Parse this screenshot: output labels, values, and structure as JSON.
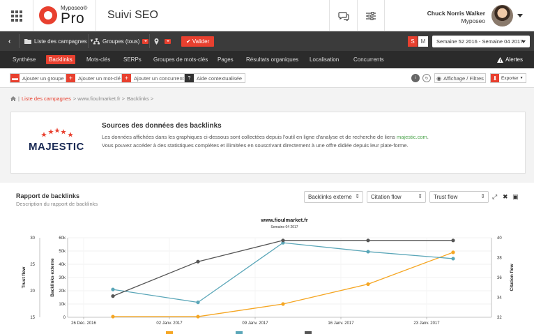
{
  "header": {
    "logo_top": "Myposeo®",
    "logo_main": "Pro",
    "app_title": "Suivi SEO",
    "user_name": "Chuck Norris Walker",
    "user_company": "Myposeo"
  },
  "toolbar": {
    "campaigns_label": "Liste des campagnes",
    "groups_label": "Groupes (tous)",
    "validate_label": "✔ Valider",
    "period_s": "S",
    "period_m": "M",
    "week_range": "Semaine 52 2016 - Semaine 04 2017"
  },
  "nav": {
    "tabs": [
      "Synthèse",
      "Backlinks",
      "Mots-clés",
      "SERPs",
      "Groupes de mots-clés",
      "Pages",
      "Résultats organiques",
      "Localisation",
      "Concurrents"
    ],
    "active": "Backlinks",
    "alerts_label": "Alertes"
  },
  "actions": {
    "add_group": "Ajouter un groupe",
    "add_keyword": "Ajouter un mot-clé",
    "add_competitor": "Ajouter un concurrent",
    "help": "Aide contextualisée",
    "display_filters": "Affichage / Filtres",
    "export": "Exporter"
  },
  "breadcrumb": {
    "campaigns": "Liste des campagnes",
    "site": "> www.fioulmarket.fr >",
    "page": "Backlinks >"
  },
  "info": {
    "brand": "MAJESTIC",
    "title": "Sources des données des backlinks",
    "line1_pre": "Les données affichées dans les graphiques ci-dessous sont collectées depuis l'outil en ligne d'analyse et de recherche de liens ",
    "line1_link": "majestic.com",
    "line1_post": ".",
    "line2": "Vous pouvez accéder à des statistiques complètes et illimitées en souscrivant directement à une offre didiée depuis leur plate-forme."
  },
  "report": {
    "title": "Rapport de backlinks",
    "subtitle": "Description du rapport de backlinks",
    "select1": "Backlinks externe",
    "select2": "Citation flow",
    "select3": "Trust flow"
  },
  "colors": {
    "accent": "#e8402f",
    "backlinks": "#f5a623",
    "citation": "#5aa6b8",
    "trust": "#555555"
  },
  "chart_data": {
    "type": "line",
    "title": "www.fioulmarket.fr",
    "subtitle": "Semaine 04 2017",
    "x_ticks": [
      "26 Déc. 2016",
      "02 Janv. 2017",
      "09 Janv. 2017",
      "16 Janv. 2017",
      "23 Janv. 2017"
    ],
    "x": [
      "Semaine 52 2016",
      "Semaine 01 2017",
      "Semaine 02 2017",
      "Semaine 03 2017",
      "Semaine 04 2017"
    ],
    "left_axis": {
      "label": "Trust flow",
      "range": [
        15,
        30
      ],
      "ticks": [
        "15",
        "20",
        "25",
        "30"
      ]
    },
    "mid_axis": {
      "label": "Backlinks externe",
      "range": [
        0,
        60000
      ],
      "ticks": [
        "0",
        "10k",
        "20k",
        "30k",
        "40k",
        "50k",
        "60k"
      ]
    },
    "right_axis": {
      "label": "Citation flow",
      "range": [
        32,
        40
      ],
      "ticks": [
        "32",
        "34",
        "36",
        "38",
        "40"
      ]
    },
    "series": [
      {
        "values": [
          500,
          500,
          10000,
          25000,
          49000
        ],
        "axis": "mid"
      },
      {
        "values": [
          34.8,
          33.5,
          39.5,
          38.6,
          37.9
        ],
        "axis": "right"
      },
      {
        "values": [
          19,
          25.5,
          29.5,
          29.5,
          29.5
        ],
        "axis": "left"
      }
    ],
    "grid": true,
    "legend": "bottom"
  }
}
